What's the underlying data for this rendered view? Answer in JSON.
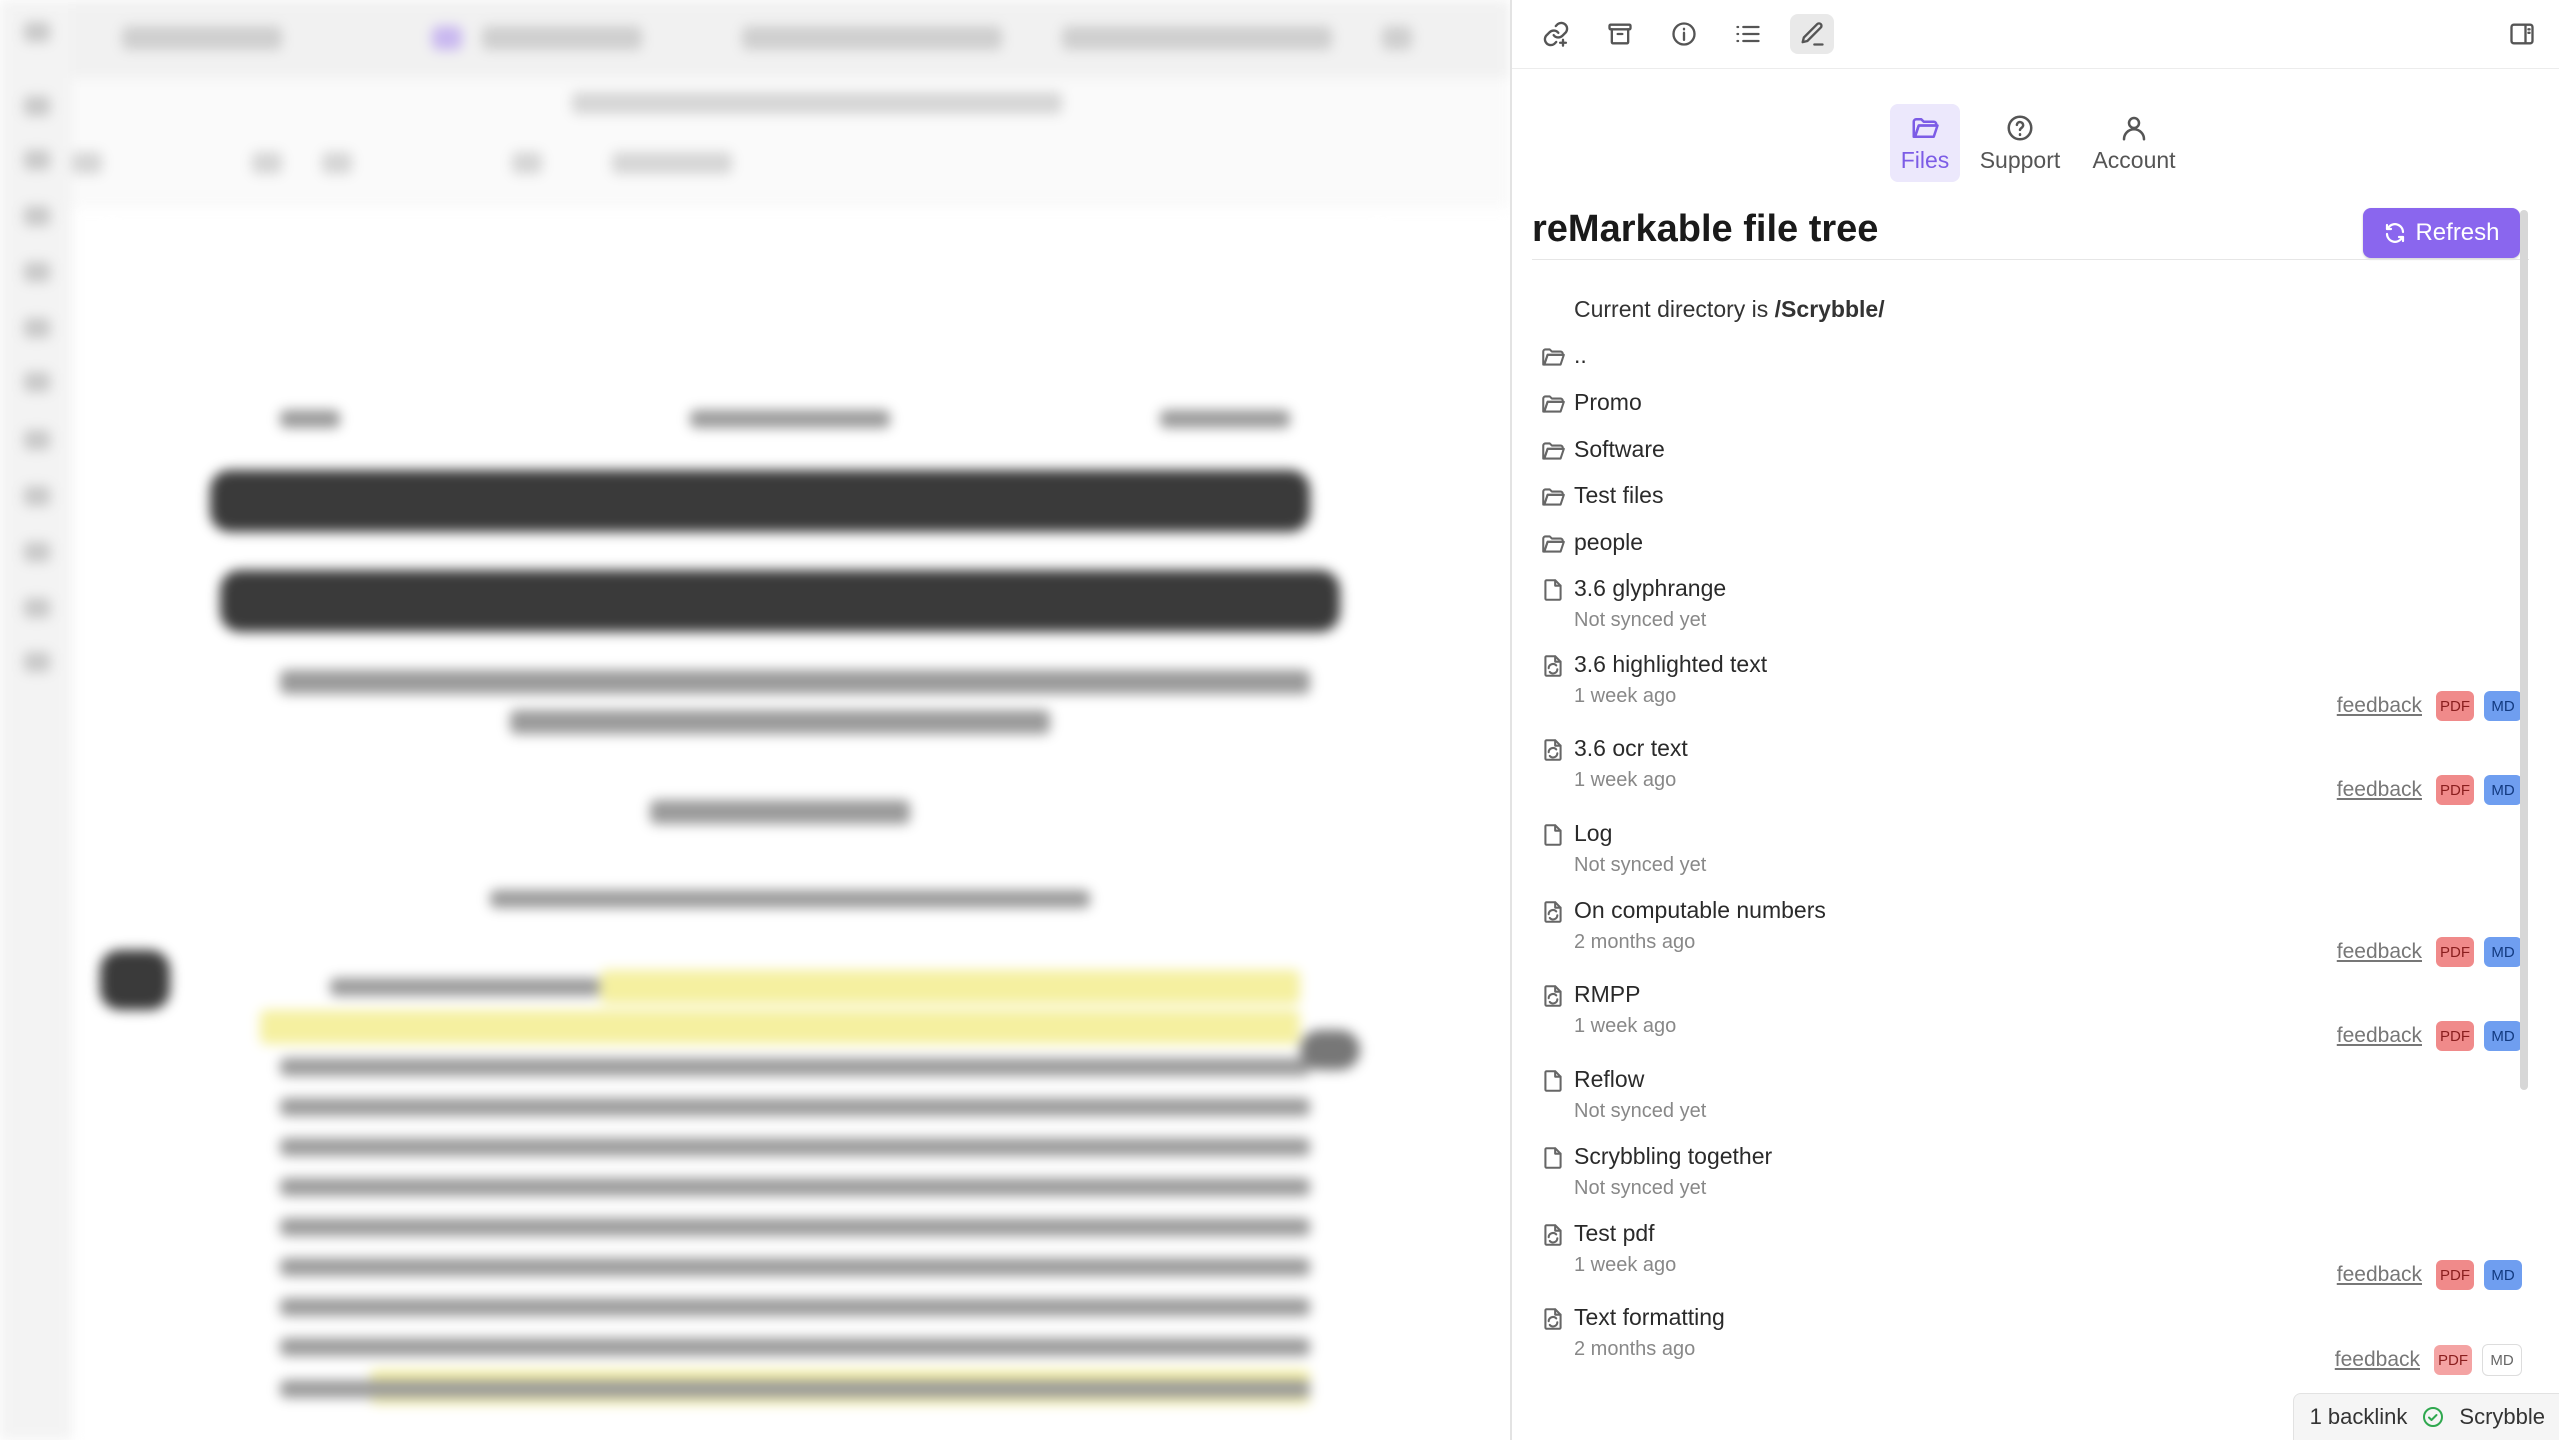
{
  "toolbar": {
    "icons": [
      "link-icon",
      "archive-icon",
      "info-icon",
      "list-icon",
      "pen-icon",
      "sidebar-toggle-icon"
    ]
  },
  "nav": {
    "files": "Files",
    "support": "Support",
    "account": "Account"
  },
  "header": {
    "title": "reMarkable file tree",
    "refresh_label": "Refresh"
  },
  "directory": {
    "prefix": "Current directory is ",
    "path": "/Scrybble/"
  },
  "folders": [
    "..",
    "Promo",
    "Software",
    "Test files",
    "people"
  ],
  "files": [
    {
      "name": "3.6 glyphrange",
      "status": "Not synced yet",
      "synced": false
    },
    {
      "name": "3.6 highlighted text",
      "status": "1 week ago",
      "synced": true,
      "feedback": "feedback",
      "pdf": "PDF",
      "md": "MD"
    },
    {
      "name": "3.6 ocr text",
      "status": "1 week ago",
      "synced": true,
      "feedback": "feedback",
      "pdf": "PDF",
      "md": "MD"
    },
    {
      "name": "Log",
      "status": "Not synced yet",
      "synced": false
    },
    {
      "name": "On computable numbers",
      "status": "2 months ago",
      "synced": true,
      "feedback": "feedback",
      "pdf": "PDF",
      "md": "MD"
    },
    {
      "name": "RMPP",
      "status": "1 week ago",
      "synced": true,
      "feedback": "feedback",
      "pdf": "PDF",
      "md": "MD"
    },
    {
      "name": "Reflow",
      "status": "Not synced yet",
      "synced": false
    },
    {
      "name": "Scrybbling together",
      "status": "Not synced yet",
      "synced": false
    },
    {
      "name": "Test pdf",
      "status": "1 week ago",
      "synced": true,
      "feedback": "feedback",
      "pdf": "PDF",
      "md": "MD"
    },
    {
      "name": "Text formatting",
      "status": "2 months ago",
      "synced": true,
      "feedback": "feedback",
      "pdf": "PDF",
      "md": "MD"
    }
  ],
  "statusbar": {
    "backlinks": "1 backlink",
    "plugin": "Scrybble"
  },
  "colors": {
    "accent": "#8a66ee",
    "pdf_badge": "#f08a8a",
    "md_badge": "#6f9ef0",
    "success": "#2fa84f"
  }
}
